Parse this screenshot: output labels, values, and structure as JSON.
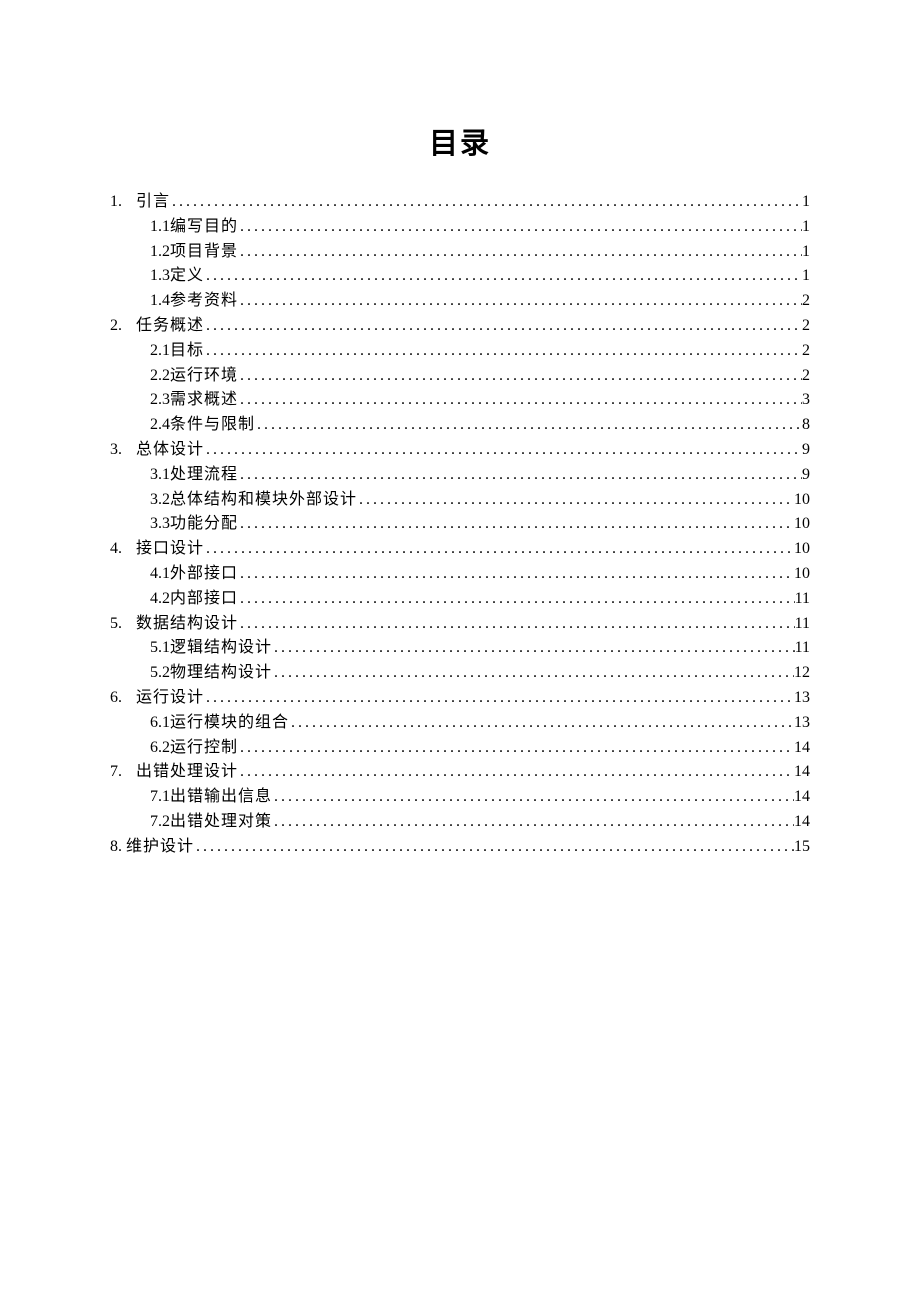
{
  "title": "目录",
  "toc": [
    {
      "level": 1,
      "number": "1.",
      "label": "引言",
      "page": "1"
    },
    {
      "level": 2,
      "number": "1.1",
      "label": "编写目的",
      "page": "1"
    },
    {
      "level": 2,
      "number": "1.2",
      "label": "项目背景",
      "page": "1"
    },
    {
      "level": 2,
      "number": "1.3",
      "label": "定义",
      "page": "1"
    },
    {
      "level": 2,
      "number": "1.4",
      "label": "参考资料",
      "page": "2"
    },
    {
      "level": 1,
      "number": "2.",
      "label": "任务概述",
      "page": "2"
    },
    {
      "level": 2,
      "number": "2.1",
      "label": "目标",
      "page": "2"
    },
    {
      "level": 2,
      "number": "2.2",
      "label": "运行环境",
      "page": "2"
    },
    {
      "level": 2,
      "number": "2.3",
      "label": "需求概述",
      "page": "3"
    },
    {
      "level": 2,
      "number": "2.4",
      "label": "条件与限制",
      "page": "8"
    },
    {
      "level": 1,
      "number": "3.",
      "label": "总体设计",
      "page": "9"
    },
    {
      "level": 2,
      "number": "3.1",
      "label": "处理流程",
      "page": "9"
    },
    {
      "level": 2,
      "number": "3.2",
      "label": "总体结构和模块外部设计",
      "page": "10"
    },
    {
      "level": 2,
      "number": "3.3",
      "label": "功能分配",
      "page": "10"
    },
    {
      "level": 1,
      "number": "4.",
      "label": "接口设计",
      "page": "10"
    },
    {
      "level": 2,
      "number": "4.1",
      "label": "外部接口",
      "page": "10"
    },
    {
      "level": 2,
      "number": "4.2",
      "label": "内部接口",
      "page": "11"
    },
    {
      "level": 1,
      "number": "5.",
      "label": "数据结构设计",
      "page": "11"
    },
    {
      "level": 2,
      "number": "5.1",
      "label": "逻辑结构设计",
      "page": "11"
    },
    {
      "level": 2,
      "number": "5.2",
      "label": "物理结构设计",
      "page": "12"
    },
    {
      "level": 1,
      "number": "6.",
      "label": "运行设计",
      "page": "13"
    },
    {
      "level": 2,
      "number": "6.1",
      "label": "运行模块的组合",
      "page": "13"
    },
    {
      "level": 2,
      "number": "6.2",
      "label": "运行控制",
      "page": "14"
    },
    {
      "level": 1,
      "number": "7.",
      "label": "出错处理设计",
      "page": "14"
    },
    {
      "level": 2,
      "number": "7.1",
      "label": "出错输出信息",
      "page": "14"
    },
    {
      "level": 2,
      "number": "7.2",
      "label": "出错处理对策",
      "page": "14"
    },
    {
      "level": 8,
      "number": "8.",
      "label": "维护设计",
      "page": "15"
    }
  ]
}
